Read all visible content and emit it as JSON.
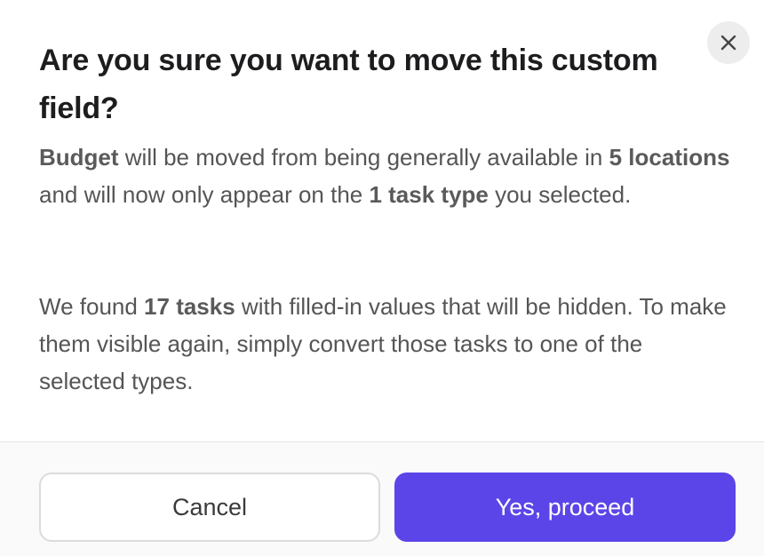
{
  "dialog": {
    "title": "Are you sure you want to move this custom field?",
    "close_icon": "close-icon",
    "paragraph1": {
      "field_name": "Budget",
      "text_a": " will be moved from being generally available in ",
      "locations": "5 locations",
      "text_b": " and will now only appear on the ",
      "task_types": "1 task type",
      "text_c": " you selected."
    },
    "paragraph2": {
      "text_a": "We found ",
      "tasks_count": "17 tasks",
      "text_b": " with filled-in values that will be hidden. To make them visible again, simply convert those tasks to one of the selected types."
    }
  },
  "footer": {
    "cancel_label": "Cancel",
    "proceed_label": "Yes, proceed"
  },
  "colors": {
    "primary": "#5b45e8",
    "close_bg": "#ededed",
    "footer_bg": "#fafafa"
  }
}
